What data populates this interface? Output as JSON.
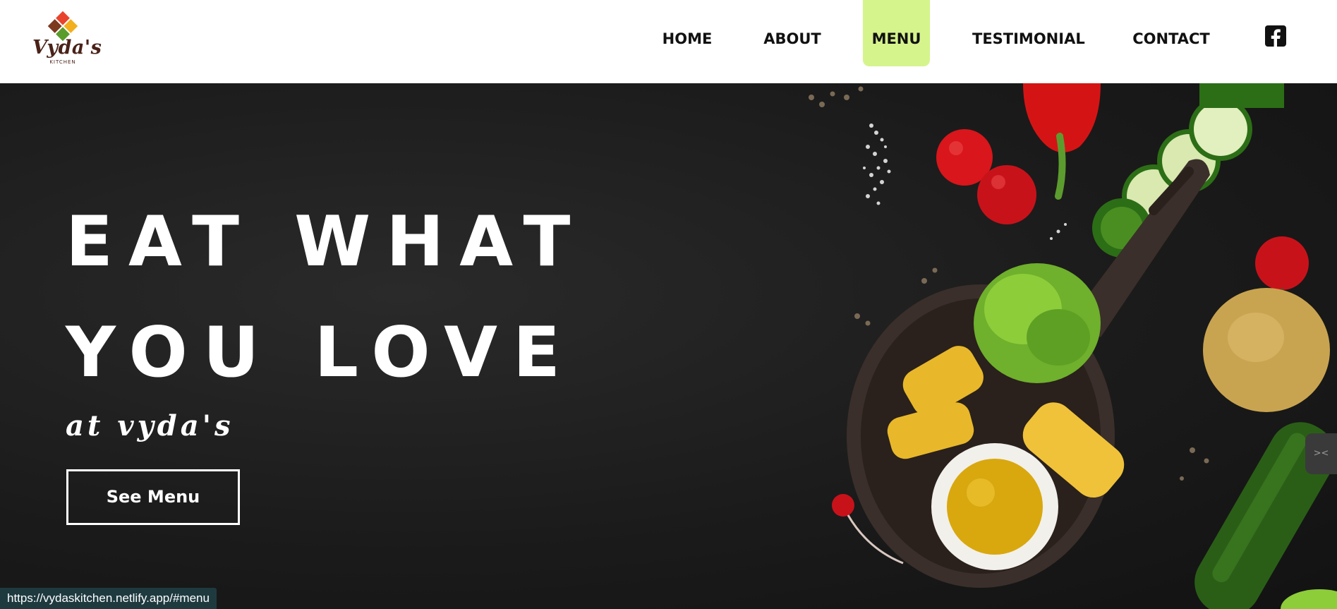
{
  "brand": {
    "logo_name": "Vyda's",
    "logo_sub": "KITCHEN",
    "colors": {
      "accent": "#d6f48c",
      "text": "#111111",
      "logo_brown": "#4a2218"
    }
  },
  "nav": {
    "items": [
      {
        "label": "HOME"
      },
      {
        "label": "ABOUT"
      },
      {
        "label": "MENU"
      },
      {
        "label": "TESTIMONIAL"
      },
      {
        "label": "CONTACT"
      }
    ],
    "active": "MENU",
    "social_icon": "facebook-icon"
  },
  "hero": {
    "title_line1": "EAT WHAT",
    "title_line2": "YOU LOVE",
    "subtitle": "at vyda's",
    "cta_label": "See Menu"
  },
  "side_tab": {
    "icon": "collapse-arrows-icon",
    "label": "><"
  },
  "status_bar": {
    "url": "https://vydaskitchen.netlify.app/#menu"
  }
}
